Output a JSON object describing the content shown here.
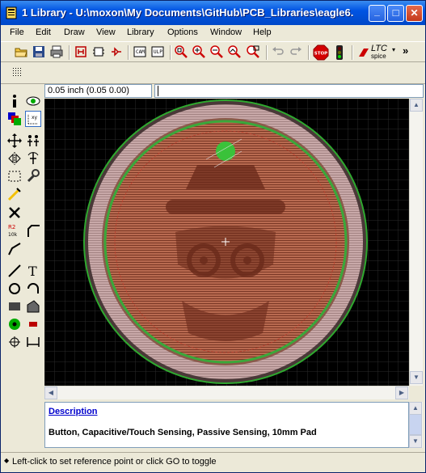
{
  "window": {
    "title": "1 Library - U:\\moxon\\My Documents\\GitHub\\PCB_Libraries\\eagle6...",
    "minimize_glyph": "_",
    "maximize_glyph": "□",
    "close_glyph": "✕"
  },
  "menu": [
    "File",
    "Edit",
    "Draw",
    "View",
    "Library",
    "Options",
    "Window",
    "Help"
  ],
  "toolbar": {
    "ltc_label": "LTC",
    "spice_label": "spice",
    "overflow_glyph": "»",
    "stop_label": "STOP"
  },
  "coordinate_readout": "0.05 inch (0.05 0.00)",
  "command_line": "",
  "description": {
    "heading": "Description",
    "text": "Button, Capacitive/Touch Sensing, Passive Sensing, 10mm Pad"
  },
  "status": {
    "text": "Left-click to set reference point or click GO to toggle"
  },
  "colors": {
    "canvas_bg": "#000000",
    "titlebar": "#0054e3",
    "link": "#0000cc"
  }
}
